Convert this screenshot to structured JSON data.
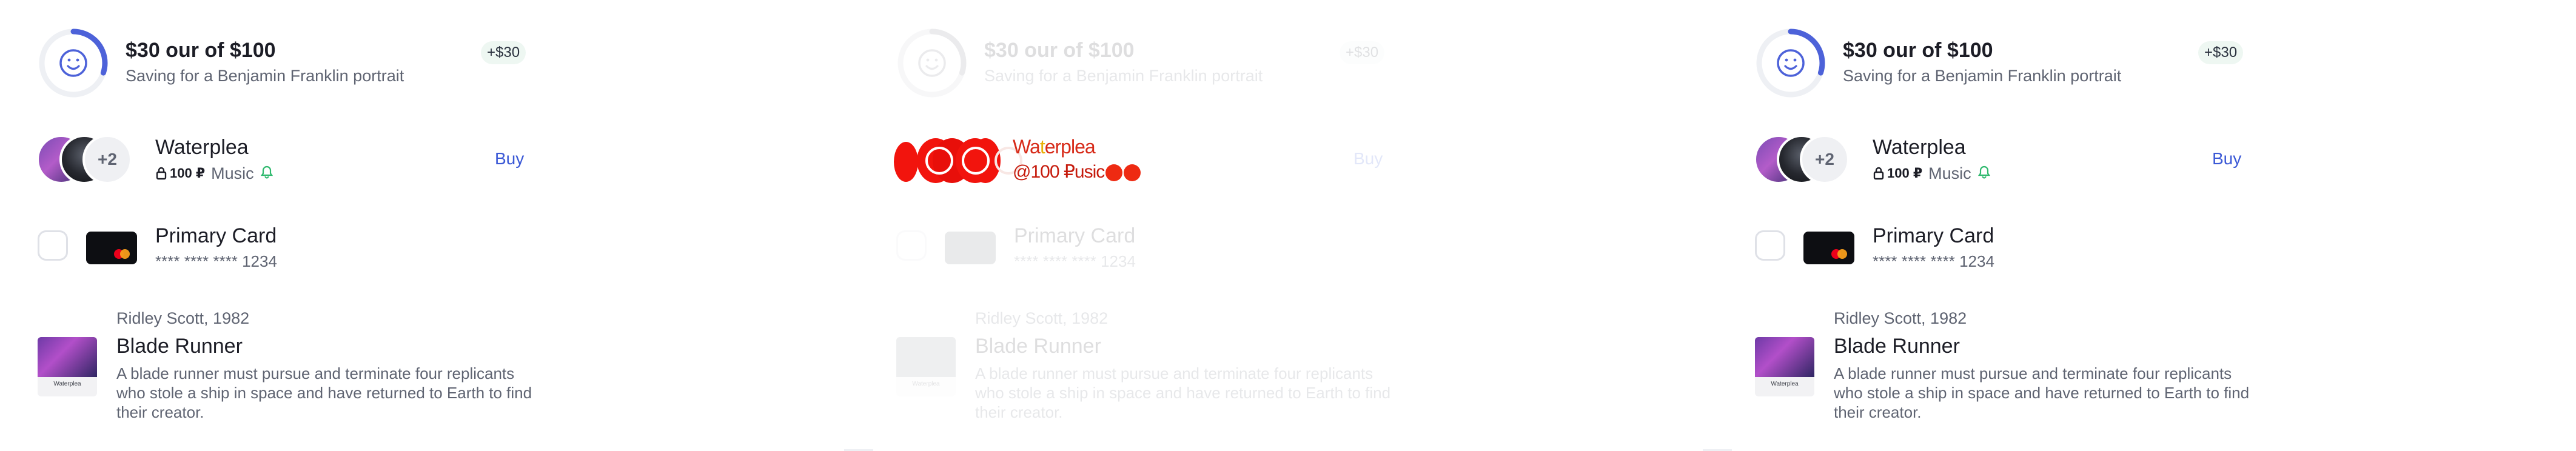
{
  "savings": {
    "amount_label": "$30 our of $100",
    "subtitle": "Saving for a Benjamin Franklin portrait",
    "badge": "+$30",
    "progress_fraction": 0.3,
    "ring_color": "#4d62d9",
    "track_color": "#eef0f4",
    "icon": "smiley-icon"
  },
  "artist": {
    "extra_count": "+2",
    "name": "Waterplea",
    "price": "100 ₽",
    "genre": "Music",
    "buy_label": "Buy",
    "icons": [
      "lock-icon",
      "bell-icon"
    ],
    "poster_caption": "Waterplea"
  },
  "payment": {
    "card_name": "Primary Card",
    "card_number": "**** **** **** 1234",
    "brand_icon": "mastercard-icon",
    "checked": false
  },
  "movie": {
    "director_year": "Ridley Scott, 1982",
    "title": "Blade Runner",
    "description": "A blade runner must pursue and terminate four replicants who stole a ship in space and have returned to Earth to find their creator.",
    "poster_caption": "Waterplea"
  },
  "overlay": {
    "line1": "Wa",
    "line1b": "t",
    "line1c": "erplea",
    "line2": "@100 ₽usic"
  },
  "colors": {
    "accent": "#3b59d6",
    "text_primary": "#1c1d26",
    "text_secondary": "#5f6472",
    "overlay_red": "#f2140d",
    "bell_green": "#2fb96e"
  }
}
